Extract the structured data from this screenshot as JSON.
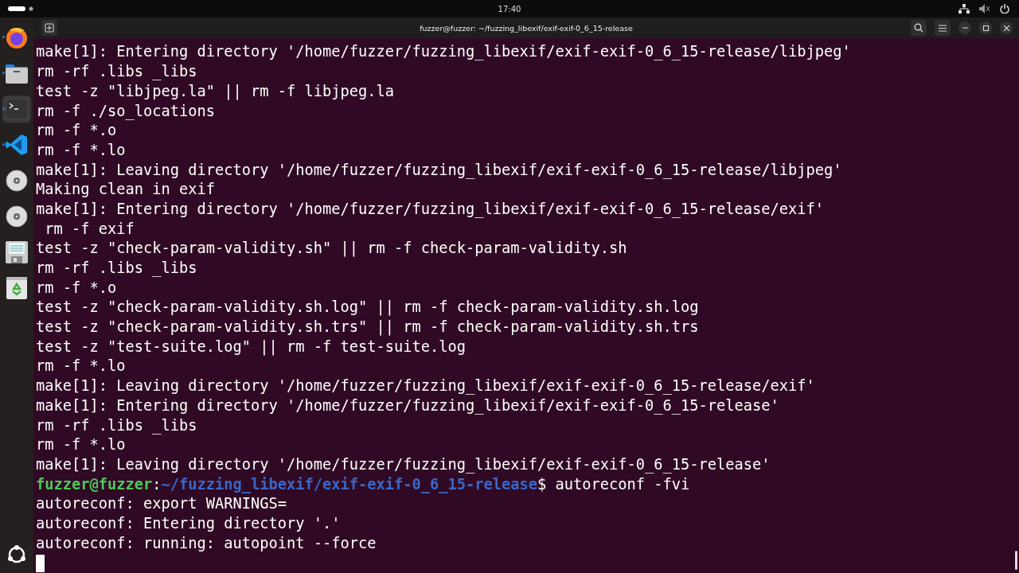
{
  "top_bar": {
    "time": "17:40"
  },
  "dock": {
    "items": [
      {
        "kind": "firefox",
        "running": true,
        "selected": false
      },
      {
        "kind": "files",
        "running": true,
        "selected": false
      },
      {
        "kind": "terminal",
        "running": true,
        "selected": true
      },
      {
        "kind": "code",
        "running": true,
        "selected": false
      },
      {
        "kind": "disc",
        "running": false,
        "selected": false
      },
      {
        "kind": "disc",
        "running": false,
        "selected": false
      },
      {
        "kind": "floppy",
        "running": false,
        "selected": false
      },
      {
        "kind": "trash",
        "running": false,
        "selected": false
      }
    ]
  },
  "terminal": {
    "title": "fuzzer@fuzzer: ~/fuzzing_libexif/exif-exif-0_6_15-release",
    "lines": [
      {
        "kind": "output",
        "text": "make[1]: Entering directory '/home/fuzzer/fuzzing_libexif/exif-exif-0_6_15-release/libjpeg'"
      },
      {
        "kind": "output",
        "text": "rm -rf .libs _libs"
      },
      {
        "kind": "output",
        "text": "test -z \"libjpeg.la\" || rm -f libjpeg.la"
      },
      {
        "kind": "output",
        "text": "rm -f ./so_locations"
      },
      {
        "kind": "output",
        "text": "rm -f *.o"
      },
      {
        "kind": "output",
        "text": "rm -f *.lo"
      },
      {
        "kind": "output",
        "text": "make[1]: Leaving directory '/home/fuzzer/fuzzing_libexif/exif-exif-0_6_15-release/libjpeg'"
      },
      {
        "kind": "output",
        "text": "Making clean in exif"
      },
      {
        "kind": "output",
        "text": "make[1]: Entering directory '/home/fuzzer/fuzzing_libexif/exif-exif-0_6_15-release/exif'"
      },
      {
        "kind": "output",
        "text": " rm -f exif"
      },
      {
        "kind": "output",
        "text": "test -z \"check-param-validity.sh\" || rm -f check-param-validity.sh"
      },
      {
        "kind": "output",
        "text": "rm -rf .libs _libs"
      },
      {
        "kind": "output",
        "text": "rm -f *.o"
      },
      {
        "kind": "output",
        "text": "test -z \"check-param-validity.sh.log\" || rm -f check-param-validity.sh.log"
      },
      {
        "kind": "output",
        "text": "test -z \"check-param-validity.sh.trs\" || rm -f check-param-validity.sh.trs"
      },
      {
        "kind": "output",
        "text": "test -z \"test-suite.log\" || rm -f test-suite.log"
      },
      {
        "kind": "output",
        "text": "rm -f *.lo"
      },
      {
        "kind": "output",
        "text": "make[1]: Leaving directory '/home/fuzzer/fuzzing_libexif/exif-exif-0_6_15-release/exif'"
      },
      {
        "kind": "output",
        "text": "make[1]: Entering directory '/home/fuzzer/fuzzing_libexif/exif-exif-0_6_15-release'"
      },
      {
        "kind": "output",
        "text": "rm -rf .libs _libs"
      },
      {
        "kind": "output",
        "text": "rm -f *.lo"
      },
      {
        "kind": "output",
        "text": "make[1]: Leaving directory '/home/fuzzer/fuzzing_libexif/exif-exif-0_6_15-release'"
      },
      {
        "kind": "prompt",
        "user": "fuzzer@fuzzer",
        "separator": ":",
        "path": "~/fuzzing_libexif/exif-exif-0_6_15-release",
        "symbol": "$",
        "command": "autoreconf -fvi"
      },
      {
        "kind": "output",
        "text": "autoreconf: export WARNINGS="
      },
      {
        "kind": "output",
        "text": "autoreconf: Entering directory '.'"
      },
      {
        "kind": "output",
        "text": "autoreconf: running: autopoint --force"
      },
      {
        "kind": "cursor"
      }
    ]
  }
}
